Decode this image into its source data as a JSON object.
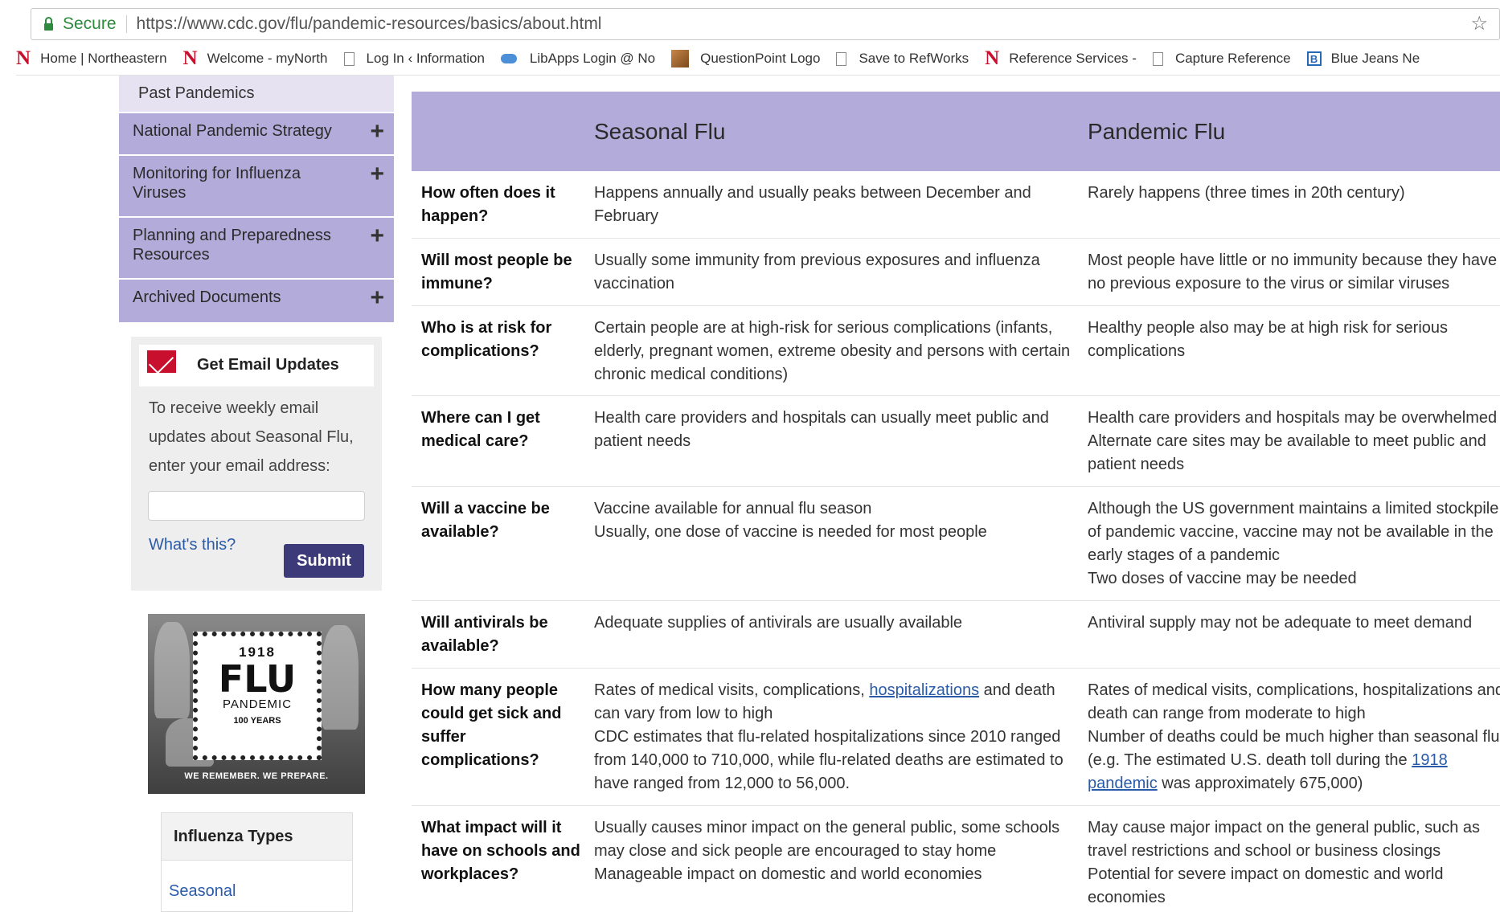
{
  "browser": {
    "secure_label": "Secure",
    "url": "https://www.cdc.gov/flu/pandemic-resources/basics/about.html",
    "bookmarks": [
      {
        "label": "Home | Northeastern",
        "icon": "northeastern-n-icon"
      },
      {
        "label": "Welcome - myNorth",
        "icon": "northeastern-n-icon"
      },
      {
        "label": "Log In ‹ Information",
        "icon": "page-icon"
      },
      {
        "label": "LibApps Login @ No",
        "icon": "cloud-icon"
      },
      {
        "label": "QuestionPoint Logo",
        "icon": "questionpoint-icon"
      },
      {
        "label": "Save to RefWorks",
        "icon": "page-icon"
      },
      {
        "label": "Reference Services -",
        "icon": "northeastern-n-icon"
      },
      {
        "label": "Capture Reference",
        "icon": "page-icon"
      },
      {
        "label": "Blue Jeans Ne",
        "icon": "bluejeans-icon"
      }
    ]
  },
  "sidebar": {
    "past_pandemics": "Past Pandemics",
    "items": [
      {
        "label": "National Pandemic Strategy"
      },
      {
        "label": "Monitoring for Influenza Viruses"
      },
      {
        "label": "Planning and Preparedness Resources"
      },
      {
        "label": "Archived Documents"
      }
    ],
    "expand_symbol": "+"
  },
  "email": {
    "title": "Get Email Updates",
    "text": "To receive weekly email updates about Seasonal Flu, enter your email address:",
    "input_value": "",
    "whats_this": "What's this?",
    "submit": "Submit"
  },
  "promo": {
    "year": "1918",
    "flu": "FLU",
    "pandemic": "PANDEMIC",
    "years": "100 YEARS",
    "tagline": "WE REMEMBER. WE PREPARE."
  },
  "influenza_types": {
    "heading": "Influenza Types",
    "link": "Seasonal"
  },
  "table": {
    "headers": {
      "seasonal": "Seasonal Flu",
      "pandemic": "Pandemic Flu"
    },
    "rows": [
      {
        "q": "How often does it happen?",
        "seasonal": "Happens annually and usually peaks between December and February",
        "pandemic": "Rarely happens (three times in 20th century)"
      },
      {
        "q": "Will most people be immune?",
        "seasonal": "Usually some immunity from previous exposures and influenza vaccination",
        "pandemic": "Most people have little or no immunity because they have no previous exposure to the virus or similar viruses"
      },
      {
        "q": "Who is at risk for complications?",
        "seasonal": "Certain people are at high-risk for serious complications (infants, elderly, pregnant women, extreme obesity and persons with certain chronic medical conditions)",
        "pandemic": "Healthy people also may be at high risk for serious complications"
      },
      {
        "q": "Where can I get medical care?",
        "seasonal": "Health care providers and hospitals can usually meet public and patient needs",
        "pandemic": "Health care providers and hospitals may be overwhelmed\nAlternate care sites may be available to meet public and patient needs"
      },
      {
        "q": "Will a vaccine be available?",
        "seasonal": "Vaccine available for annual flu season\nUsually, one dose of vaccine is needed for most people",
        "pandemic": "Although the US government maintains a limited stockpile of pandemic vaccine, vaccine may not be available in the early stages of a pandemic\nTwo doses of vaccine may be needed"
      },
      {
        "q": "Will antivirals be available?",
        "seasonal": "Adequate supplies of antivirals are usually available",
        "pandemic": "Antiviral supply may not be adequate to meet demand"
      },
      {
        "q": "How many people could get sick and suffer complications?",
        "seasonal_a": "Rates of medical visits, complications, ",
        "seasonal_link": "hospitalizations",
        "seasonal_b": " and death can vary from low to high",
        "seasonal_c": "CDC estimates that flu-related hospitalizations since 2010 ranged from 140,000 to 710,000, while flu-related deaths are estimated to have ranged from 12,000 to 56,000.",
        "pandemic_a": "Rates of medical visits, complications, hospitalizations and death can range from moderate to high",
        "pandemic_b": "Number of deaths could be much higher than seasonal flu (e.g. The estimated U.S. death toll during the ",
        "pandemic_link": "1918 pandemic",
        "pandemic_c": " was approximately 675,000)"
      },
      {
        "q": "What impact will it have on schools and workplaces?",
        "seasonal": "Usually causes minor impact on the general public, some schools may close and sick people are encouraged to stay home\nManageable impact on domestic and world economies",
        "pandemic": "May cause major impact on the general public, such as travel restrictions and school or business closings\nPotential for severe impact on domestic and world economies"
      }
    ]
  }
}
